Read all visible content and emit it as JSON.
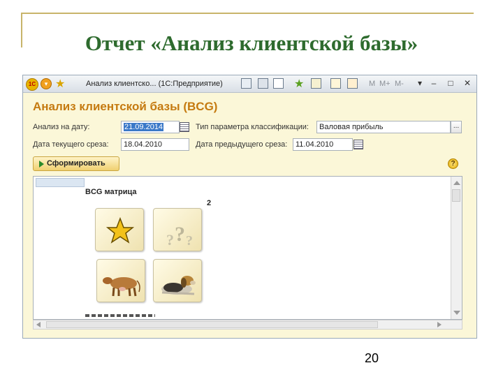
{
  "slide": {
    "title": "Отчет «Анализ клиентской базы»",
    "page_number": "20"
  },
  "window": {
    "title": "Анализ клиентско... (1С:Предприятие)",
    "logo_text": "1С",
    "memory_buttons": [
      "M",
      "M+",
      "M-"
    ],
    "controls": [
      "▾",
      "–",
      "□",
      "✕"
    ]
  },
  "form": {
    "title": "Анализ клиентской базы (BCG)",
    "analysis_date_label": "Анализ на дату:",
    "analysis_date_value": "21.09.2014",
    "classification_param_label": "Тип параметра классификации:",
    "classification_param_value": "Валовая прибыль",
    "current_slice_label": "Дата текущего среза:",
    "current_slice_value": "18.04.2010",
    "previous_slice_label": "Дата предыдущего среза:",
    "previous_slice_value": "11.04.2010",
    "generate_button": "Сформировать",
    "help_symbol": "?",
    "dots_symbol": "..."
  },
  "report": {
    "matrix_title": "BCG матрица",
    "marker_number": "2",
    "tiles": [
      "star-icon",
      "question-mark-icon",
      "cow-icon",
      "dog-icon"
    ]
  }
}
